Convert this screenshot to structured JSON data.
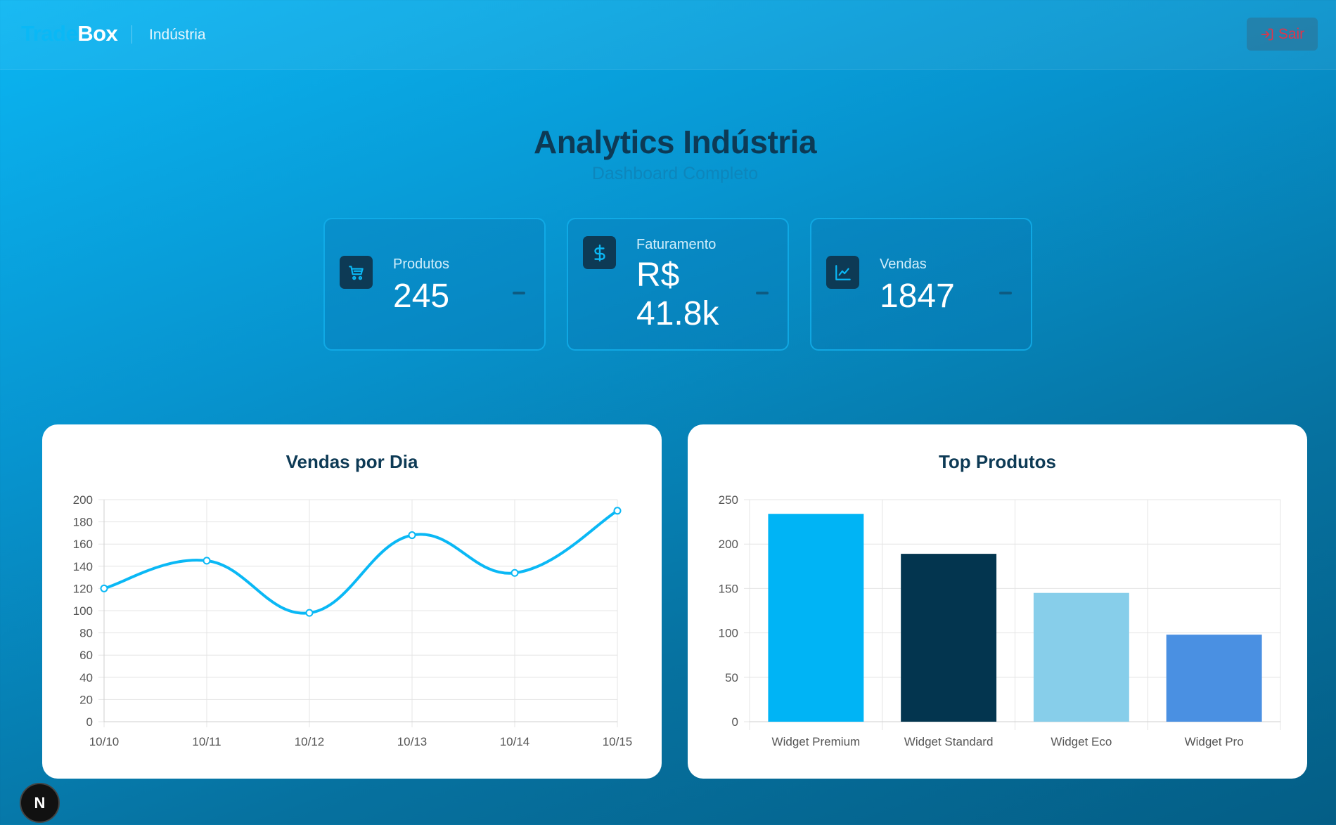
{
  "header": {
    "brand_part1": "Trade",
    "brand_part2": "Box",
    "section": "Indústria",
    "logout_label": "Sair"
  },
  "page": {
    "title": "Analytics Indústria",
    "subtitle": "Dashboard Completo"
  },
  "kpis": [
    {
      "label": "Produtos",
      "value": "245",
      "icon": "shopping-cart-icon"
    },
    {
      "label": "Faturamento",
      "value": "R$ 41.8k",
      "icon": "dollar-icon"
    },
    {
      "label": "Vendas",
      "value": "1847",
      "icon": "line-chart-icon"
    }
  ],
  "next_badge": "N",
  "colors": {
    "accent": "#0ab8f5",
    "dark": "#0d3a55",
    "logout": "#e0344a"
  },
  "chart_data": [
    {
      "type": "line",
      "title": "Vendas por Dia",
      "x": [
        "10/10",
        "10/11",
        "10/12",
        "10/13",
        "10/14",
        "10/15"
      ],
      "series": [
        {
          "values": [
            120,
            145,
            98,
            168,
            134,
            190
          ],
          "color": "#0ab8f5"
        }
      ],
      "ylim": [
        0,
        200
      ],
      "yticks": [
        0,
        20,
        40,
        60,
        80,
        100,
        120,
        140,
        160,
        180,
        200
      ],
      "grid": true,
      "xlabel": "",
      "ylabel": ""
    },
    {
      "type": "bar",
      "title": "Top Produtos",
      "categories": [
        "Widget Premium",
        "Widget Standard",
        "Widget Eco",
        "Widget Pro"
      ],
      "values": [
        234,
        189,
        145,
        98
      ],
      "colors": [
        "#00b4f5",
        "#03354f",
        "#87ceea",
        "#4a90e2"
      ],
      "ylim": [
        0,
        250
      ],
      "yticks": [
        0,
        50,
        100,
        150,
        200,
        250
      ],
      "grid": true,
      "xlabel": "",
      "ylabel": ""
    }
  ]
}
